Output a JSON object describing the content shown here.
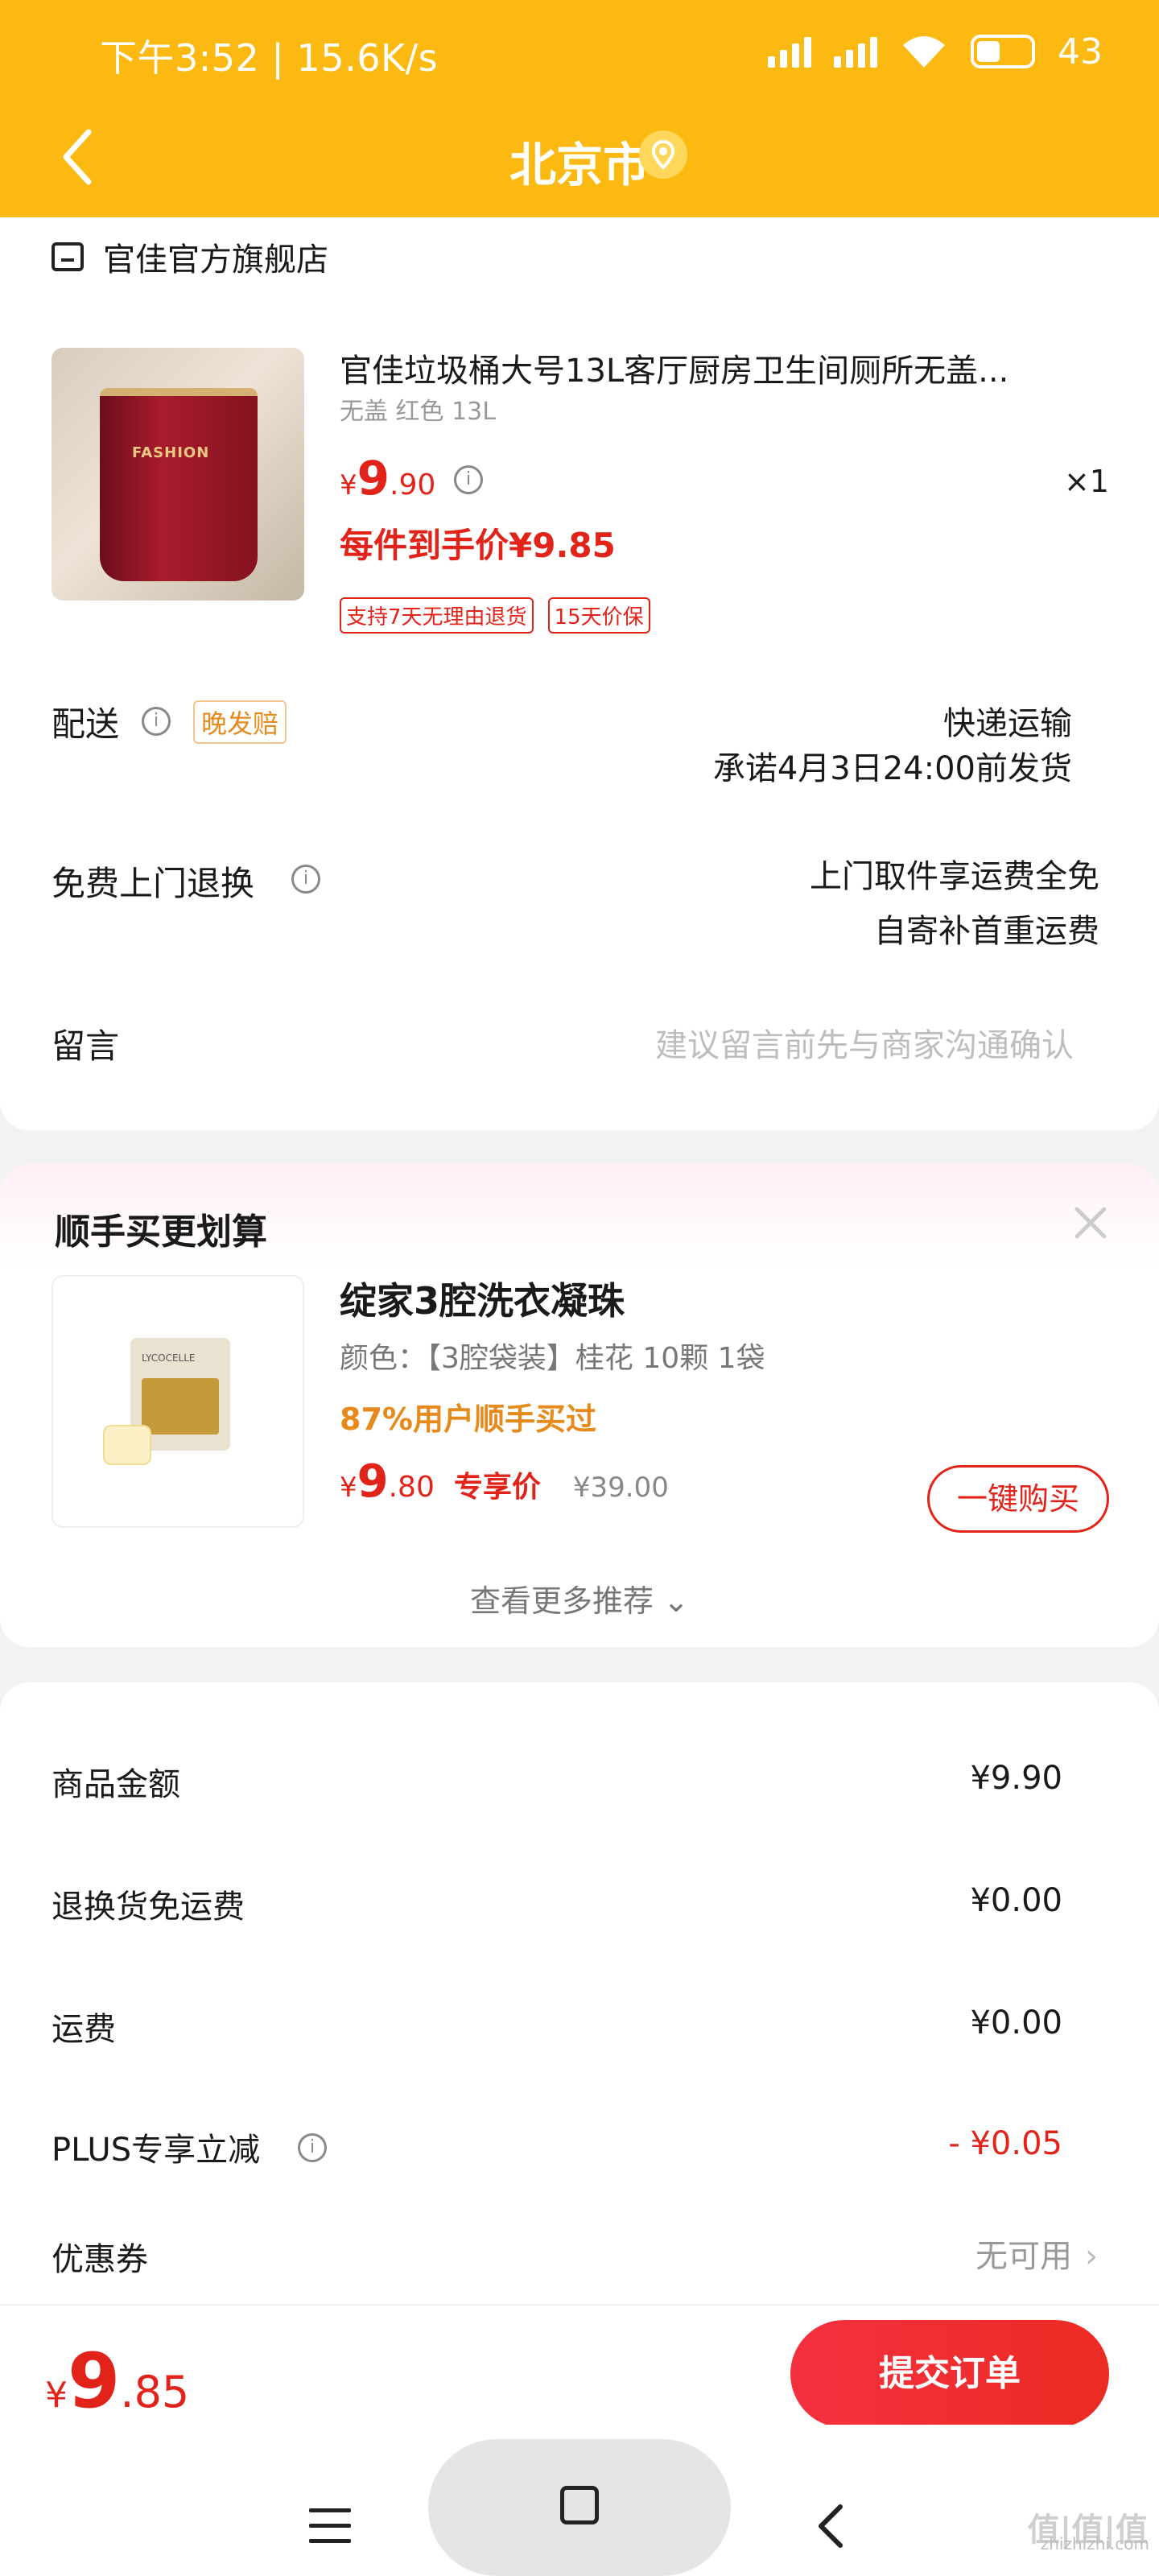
{
  "status_bar": {
    "time": "下午3:52 | 15.6K/s",
    "battery": "43"
  },
  "header": {
    "title": "北京市"
  },
  "order": {
    "store_name": "官佳官方旗舰店",
    "product": {
      "title": "官佳垃圾桶大号13L客厅厨房卫生间厕所无盖...",
      "spec": "无盖 红色 13L",
      "image_label": "FASHION",
      "price_symbol": "¥",
      "price_int": "9",
      "price_dec": ".90",
      "quantity": "×1",
      "final_price": "每件到手价¥9.85",
      "tags": [
        "支持7天无理由退货",
        "15天价保"
      ]
    },
    "delivery": {
      "label": "配送",
      "late_tag": "晚发赔",
      "method": "快递运输",
      "promise": "承诺4月3日24:00前发货"
    },
    "return": {
      "label": "免费上门退换",
      "line1": "上门取件享运费全免",
      "line2": "自寄补首重运费"
    },
    "message": {
      "label": "留言",
      "placeholder": "建议留言前先与商家沟通确认"
    }
  },
  "recommend": {
    "title": "顺手买更划算",
    "item": {
      "name": "绽家3腔洗衣凝珠",
      "spec": "颜色：【3腔袋装】桂花 10颗 1袋",
      "bought": "87%用户顺手买过",
      "price_symbol": "¥",
      "price_int": "9",
      "price_dec": ".80",
      "exclusive": "专享价",
      "original_price": "¥39.00",
      "buy_label": "一键购买",
      "image_label": "LYCOCELLE"
    },
    "more": "查看更多推荐 ⌄"
  },
  "summary": {
    "rows": [
      {
        "label": "商品金额",
        "value": "¥9.90"
      },
      {
        "label": "退换货免运费",
        "value": "¥0.00"
      },
      {
        "label": "运费",
        "value": "¥0.00"
      },
      {
        "label": "PLUS专享立减",
        "value": "- ¥0.05"
      },
      {
        "label": "优惠券",
        "value": "无可用"
      }
    ]
  },
  "bottom": {
    "total_symbol": "¥",
    "total_int": "9",
    "total_dec": ".85",
    "submit_label": "提交订单"
  },
  "watermark": {
    "main": "值|值|值",
    "sub": "zhizhizhi.com"
  },
  "colors": {
    "header": "#fcb911",
    "accent": "#e2231a",
    "orange": "#e68a1c"
  }
}
